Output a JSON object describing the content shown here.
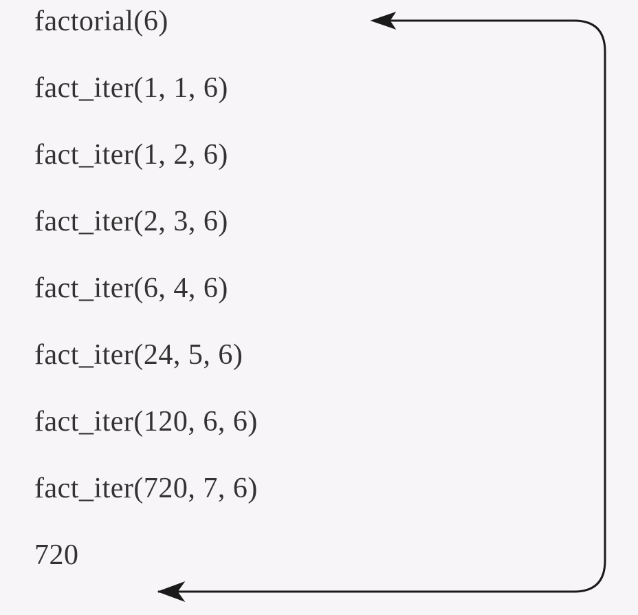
{
  "lines": [
    "factorial(6)",
    "fact_iter(1, 1, 6)",
    "fact_iter(1, 2, 6)",
    "fact_iter(2, 3, 6)",
    "fact_iter(6, 4, 6)",
    "fact_iter(24, 5, 6)",
    "fact_iter(120, 6, 6)",
    "fact_iter(720, 7, 6)",
    "720"
  ]
}
